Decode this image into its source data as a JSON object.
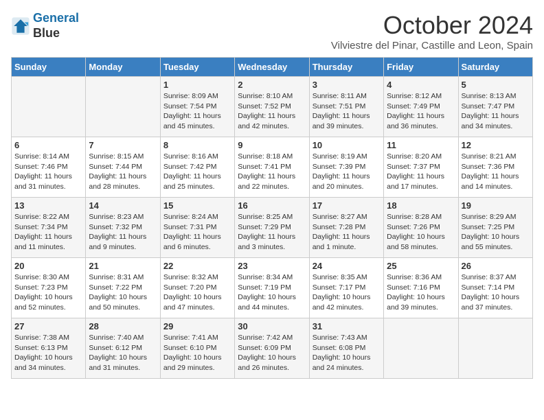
{
  "header": {
    "logo_line1": "General",
    "logo_line2": "Blue",
    "month_title": "October 2024",
    "location": "Vilviestre del Pinar, Castille and Leon, Spain"
  },
  "weekdays": [
    "Sunday",
    "Monday",
    "Tuesday",
    "Wednesday",
    "Thursday",
    "Friday",
    "Saturday"
  ],
  "weeks": [
    [
      {
        "day": "",
        "info": ""
      },
      {
        "day": "",
        "info": ""
      },
      {
        "day": "1",
        "info": "Sunrise: 8:09 AM\nSunset: 7:54 PM\nDaylight: 11 hours and 45 minutes."
      },
      {
        "day": "2",
        "info": "Sunrise: 8:10 AM\nSunset: 7:52 PM\nDaylight: 11 hours and 42 minutes."
      },
      {
        "day": "3",
        "info": "Sunrise: 8:11 AM\nSunset: 7:51 PM\nDaylight: 11 hours and 39 minutes."
      },
      {
        "day": "4",
        "info": "Sunrise: 8:12 AM\nSunset: 7:49 PM\nDaylight: 11 hours and 36 minutes."
      },
      {
        "day": "5",
        "info": "Sunrise: 8:13 AM\nSunset: 7:47 PM\nDaylight: 11 hours and 34 minutes."
      }
    ],
    [
      {
        "day": "6",
        "info": "Sunrise: 8:14 AM\nSunset: 7:46 PM\nDaylight: 11 hours and 31 minutes."
      },
      {
        "day": "7",
        "info": "Sunrise: 8:15 AM\nSunset: 7:44 PM\nDaylight: 11 hours and 28 minutes."
      },
      {
        "day": "8",
        "info": "Sunrise: 8:16 AM\nSunset: 7:42 PM\nDaylight: 11 hours and 25 minutes."
      },
      {
        "day": "9",
        "info": "Sunrise: 8:18 AM\nSunset: 7:41 PM\nDaylight: 11 hours and 22 minutes."
      },
      {
        "day": "10",
        "info": "Sunrise: 8:19 AM\nSunset: 7:39 PM\nDaylight: 11 hours and 20 minutes."
      },
      {
        "day": "11",
        "info": "Sunrise: 8:20 AM\nSunset: 7:37 PM\nDaylight: 11 hours and 17 minutes."
      },
      {
        "day": "12",
        "info": "Sunrise: 8:21 AM\nSunset: 7:36 PM\nDaylight: 11 hours and 14 minutes."
      }
    ],
    [
      {
        "day": "13",
        "info": "Sunrise: 8:22 AM\nSunset: 7:34 PM\nDaylight: 11 hours and 11 minutes."
      },
      {
        "day": "14",
        "info": "Sunrise: 8:23 AM\nSunset: 7:32 PM\nDaylight: 11 hours and 9 minutes."
      },
      {
        "day": "15",
        "info": "Sunrise: 8:24 AM\nSunset: 7:31 PM\nDaylight: 11 hours and 6 minutes."
      },
      {
        "day": "16",
        "info": "Sunrise: 8:25 AM\nSunset: 7:29 PM\nDaylight: 11 hours and 3 minutes."
      },
      {
        "day": "17",
        "info": "Sunrise: 8:27 AM\nSunset: 7:28 PM\nDaylight: 11 hours and 1 minute."
      },
      {
        "day": "18",
        "info": "Sunrise: 8:28 AM\nSunset: 7:26 PM\nDaylight: 10 hours and 58 minutes."
      },
      {
        "day": "19",
        "info": "Sunrise: 8:29 AM\nSunset: 7:25 PM\nDaylight: 10 hours and 55 minutes."
      }
    ],
    [
      {
        "day": "20",
        "info": "Sunrise: 8:30 AM\nSunset: 7:23 PM\nDaylight: 10 hours and 52 minutes."
      },
      {
        "day": "21",
        "info": "Sunrise: 8:31 AM\nSunset: 7:22 PM\nDaylight: 10 hours and 50 minutes."
      },
      {
        "day": "22",
        "info": "Sunrise: 8:32 AM\nSunset: 7:20 PM\nDaylight: 10 hours and 47 minutes."
      },
      {
        "day": "23",
        "info": "Sunrise: 8:34 AM\nSunset: 7:19 PM\nDaylight: 10 hours and 44 minutes."
      },
      {
        "day": "24",
        "info": "Sunrise: 8:35 AM\nSunset: 7:17 PM\nDaylight: 10 hours and 42 minutes."
      },
      {
        "day": "25",
        "info": "Sunrise: 8:36 AM\nSunset: 7:16 PM\nDaylight: 10 hours and 39 minutes."
      },
      {
        "day": "26",
        "info": "Sunrise: 8:37 AM\nSunset: 7:14 PM\nDaylight: 10 hours and 37 minutes."
      }
    ],
    [
      {
        "day": "27",
        "info": "Sunrise: 7:38 AM\nSunset: 6:13 PM\nDaylight: 10 hours and 34 minutes."
      },
      {
        "day": "28",
        "info": "Sunrise: 7:40 AM\nSunset: 6:12 PM\nDaylight: 10 hours and 31 minutes."
      },
      {
        "day": "29",
        "info": "Sunrise: 7:41 AM\nSunset: 6:10 PM\nDaylight: 10 hours and 29 minutes."
      },
      {
        "day": "30",
        "info": "Sunrise: 7:42 AM\nSunset: 6:09 PM\nDaylight: 10 hours and 26 minutes."
      },
      {
        "day": "31",
        "info": "Sunrise: 7:43 AM\nSunset: 6:08 PM\nDaylight: 10 hours and 24 minutes."
      },
      {
        "day": "",
        "info": ""
      },
      {
        "day": "",
        "info": ""
      }
    ]
  ]
}
